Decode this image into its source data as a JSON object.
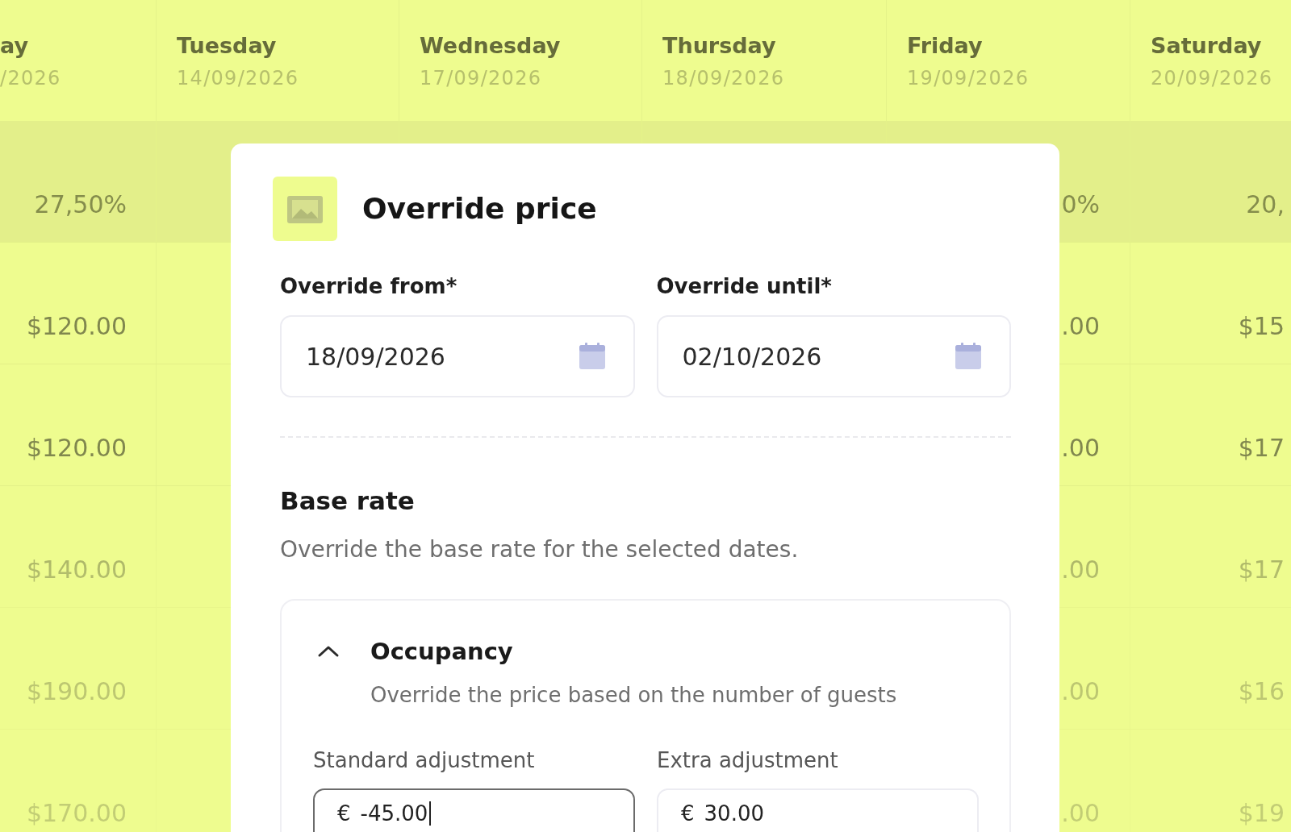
{
  "table": {
    "columns": [
      {
        "day": "ay",
        "date": "/2026"
      },
      {
        "day": "Tuesday",
        "date": "14/09/2026"
      },
      {
        "day": "Wednesday",
        "date": "17/09/2026"
      },
      {
        "day": "Thursday",
        "date": "18/09/2026"
      },
      {
        "day": "Friday",
        "date": "19/09/2026"
      },
      {
        "day": "Saturday",
        "date": "20/09/2026"
      }
    ],
    "rows": [
      {
        "kind": "percent",
        "cells": [
          "27,50%",
          null,
          null,
          null,
          "0%",
          "20,"
        ]
      },
      {
        "kind": "price",
        "cells": [
          "$120.00",
          null,
          null,
          null,
          ".00",
          "$15"
        ]
      },
      {
        "kind": "price",
        "cells": [
          "$120.00",
          null,
          null,
          null,
          ".00",
          "$17"
        ]
      },
      {
        "kind": "price",
        "cells": [
          "$140.00",
          null,
          null,
          null,
          ".00",
          "$17"
        ]
      },
      {
        "kind": "price",
        "cells": [
          "$190.00",
          null,
          null,
          null,
          ".00",
          "$16"
        ]
      },
      {
        "kind": "price",
        "cells": [
          "$170.00",
          null,
          null,
          null,
          ".00",
          "$19"
        ]
      }
    ]
  },
  "dialog": {
    "title": "Override price",
    "date_fields": [
      {
        "label": "Override from*",
        "value": "18/09/2026"
      },
      {
        "label": "Override until*",
        "value": "02/10/2026"
      }
    ],
    "section": {
      "title": "Base rate",
      "description": "Override the base rate for the selected dates."
    },
    "panel": {
      "title": "Occupancy",
      "expanded": true,
      "description": "Override the price based on the number of guests",
      "fields": [
        {
          "label": "Standard adjustment",
          "prefix": "€",
          "value": "-45.00",
          "focused": true
        },
        {
          "label": "Extra adjustment",
          "prefix": "€",
          "value": "30.00",
          "focused": false
        }
      ]
    }
  }
}
